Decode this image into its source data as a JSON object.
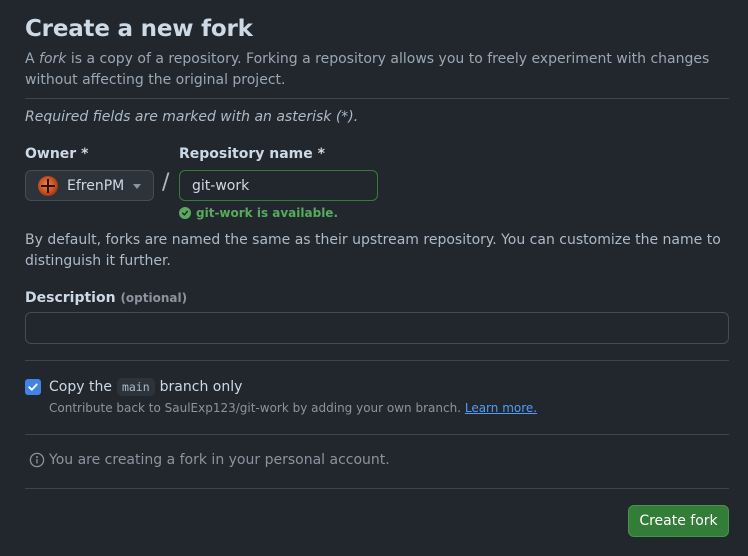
{
  "header": {
    "title": "Create a new fork",
    "intro_prefix": "A ",
    "intro_emphasis": "fork",
    "intro_rest": " is a copy of a repository. Forking a repository allows you to freely experiment with changes without affecting the original project."
  },
  "form": {
    "required_note": "Required fields are marked with an asterisk (*).",
    "owner_label": "Owner *",
    "owner_value": "EfrenPM",
    "separator": "/",
    "repo_label": "Repository name *",
    "repo_value": "git-work",
    "availability": "git-work is available.",
    "help_text": "By default, forks are named the same as their upstream repository. You can customize the name to distinguish it further.",
    "description_label": "Description",
    "description_optional": "(optional)",
    "description_value": "",
    "copy_prefix": "Copy the",
    "copy_branch": "main",
    "copy_suffix": "branch only",
    "copy_checked": true,
    "copy_sub_text": "Contribute back to SaulExp123/git-work by adding your own branch.",
    "copy_sub_link": "Learn more.",
    "info_text": "You are creating a fork in your personal account.",
    "submit_label": "Create fork"
  },
  "colors": {
    "background": "#22272e",
    "accent_green": "#347d39",
    "success_text": "#57ab5a",
    "link": "#539bf5",
    "checkbox": "#4184e4"
  },
  "icons": {
    "owner_avatar": "avatar",
    "owner_caret": "triangle-down-icon",
    "availability": "check-circle-icon",
    "checkbox": "check-icon",
    "info": "info-icon"
  }
}
